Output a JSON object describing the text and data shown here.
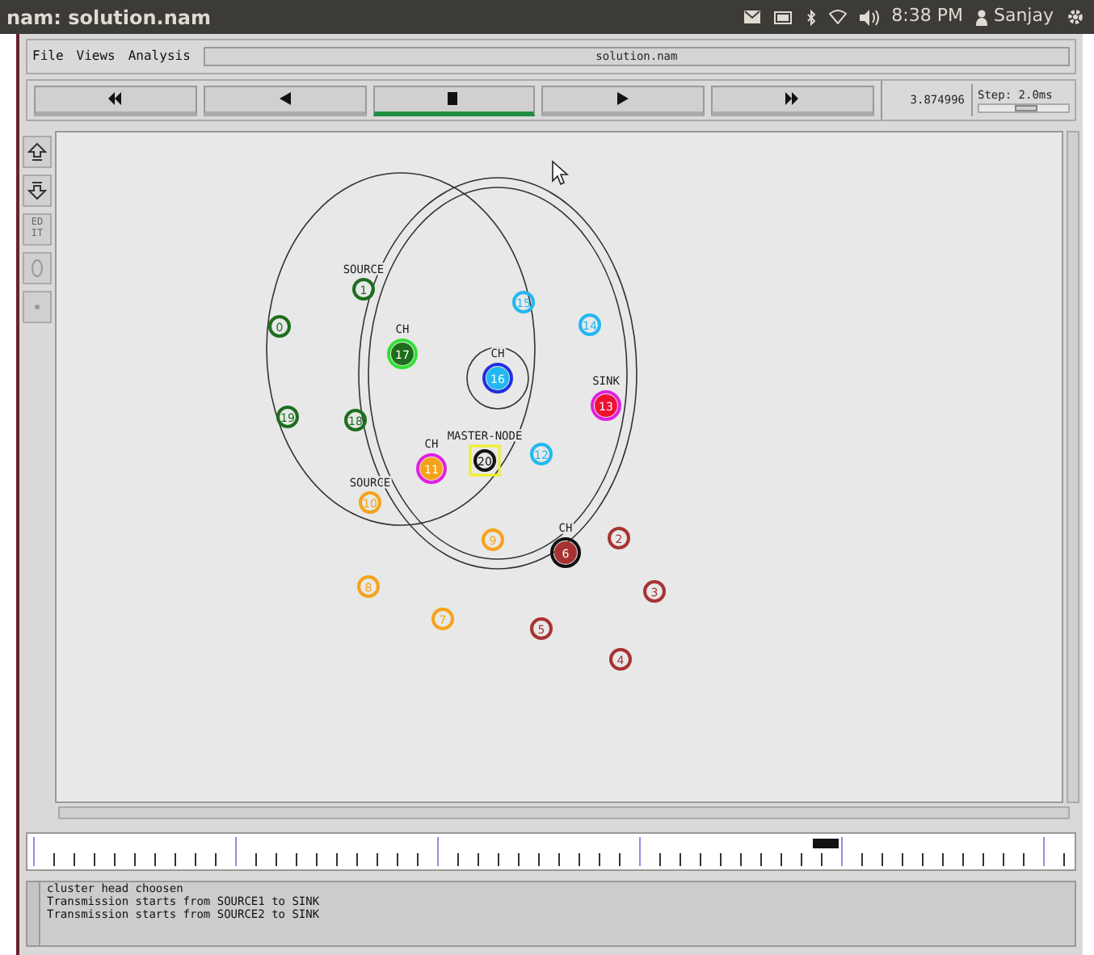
{
  "window": {
    "title": "nam: solution.nam"
  },
  "top_bar": {
    "time": "8:38 PM",
    "user": "Sanjay"
  },
  "menu": [
    "File",
    "Views",
    "Analysis"
  ],
  "file_name": "solution.nam",
  "playback": [
    {
      "kind": "rewind",
      "selected": false
    },
    {
      "kind": "back",
      "selected": false
    },
    {
      "kind": "stop",
      "selected": true
    },
    {
      "kind": "play",
      "selected": false
    },
    {
      "kind": "forward",
      "selected": false
    }
  ],
  "sim_time": "3.874996",
  "step": {
    "label": "Step: 2.0ms",
    "level": 0.55
  },
  "edit_tool": "EDIT",
  "nodes": [
    {
      "label": "0",
      "color": "#1e6e1e"
    },
    {
      "label": "1",
      "color": "#1e6e1e",
      "caption": "SOURCE"
    },
    {
      "label": "2",
      "color": "#a83232"
    },
    {
      "label": "3",
      "color": "#a83232"
    },
    {
      "label": "4",
      "color": "#a83232"
    },
    {
      "label": "5",
      "color": "#a83232"
    },
    {
      "label": "6",
      "color": "#a83232",
      "caption": "CH",
      "ring": {
        "color": "#111111"
      }
    },
    {
      "label": "7",
      "color": "#f5a31a"
    },
    {
      "label": "8",
      "color": "#f5a31a"
    },
    {
      "label": "9",
      "color": "#f5a31a"
    },
    {
      "label": "10",
      "color": "#f5a31a",
      "caption": "SOURCE"
    },
    {
      "label": "11",
      "color": "#f5a31a",
      "caption": "CH",
      "ring": {
        "color": "#e020e0"
      }
    },
    {
      "label": "12",
      "color": "#22b8f0"
    },
    {
      "label": "13",
      "color": "#f01030",
      "caption": "SINK",
      "ring": {
        "color": "#e020e0"
      }
    },
    {
      "label": "14",
      "color": "#22b8f0"
    },
    {
      "label": "15",
      "color": "#22b8f0"
    },
    {
      "label": "16",
      "color": "#22b8f0",
      "caption": "CH",
      "ring": {
        "color": "#2030e0"
      }
    },
    {
      "label": "17",
      "color": "#1e6e1e",
      "caption": "CH",
      "ring": {
        "color": "#33e033"
      }
    },
    {
      "label": "18",
      "color": "#1e6e1e"
    },
    {
      "label": "19",
      "color": "#1e6e1e"
    },
    {
      "label": "20",
      "color": "#111111",
      "caption": "MASTER-NODE",
      "box": {
        "color": "#f0f020"
      }
    }
  ],
  "log": [
    "cluster head choosen",
    "Transmission starts from SOURCE1 to SINK",
    "Transmission starts from SOURCE2 to SINK"
  ]
}
